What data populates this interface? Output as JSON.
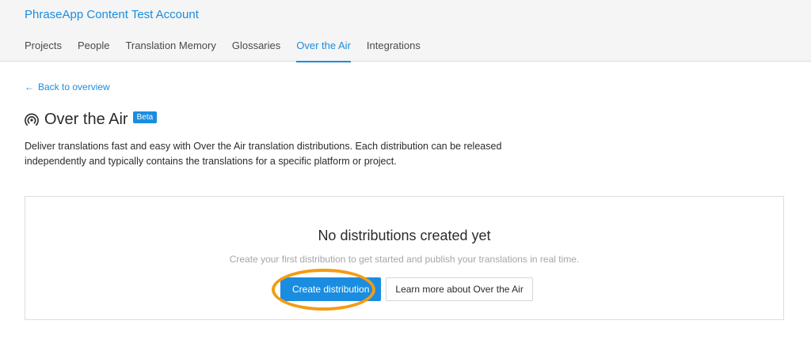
{
  "header": {
    "account_name": "PhraseApp Content Test Account",
    "tabs": [
      {
        "label": "Projects"
      },
      {
        "label": "People"
      },
      {
        "label": "Translation Memory"
      },
      {
        "label": "Glossaries"
      },
      {
        "label": "Over the Air"
      },
      {
        "label": "Integrations"
      }
    ],
    "active_tab": "Over the Air"
  },
  "page": {
    "back_link": "Back to overview",
    "title": "Over the Air",
    "badge": "Beta",
    "description": "Deliver translations fast and easy with Over the Air translation distributions. Each distribution can be released independently and typically contains the translations for a specific platform or project."
  },
  "empty_state": {
    "title": "No distributions created yet",
    "subtitle": "Create your first distribution to get started and publish your translations in real time.",
    "primary_button": "Create distribution",
    "secondary_button": "Learn more about Over the Air"
  },
  "colors": {
    "accent": "#1a8de0",
    "highlight": "#f39c12"
  },
  "icons": {
    "back": "arrow-left-icon",
    "title": "broadcast-icon"
  }
}
